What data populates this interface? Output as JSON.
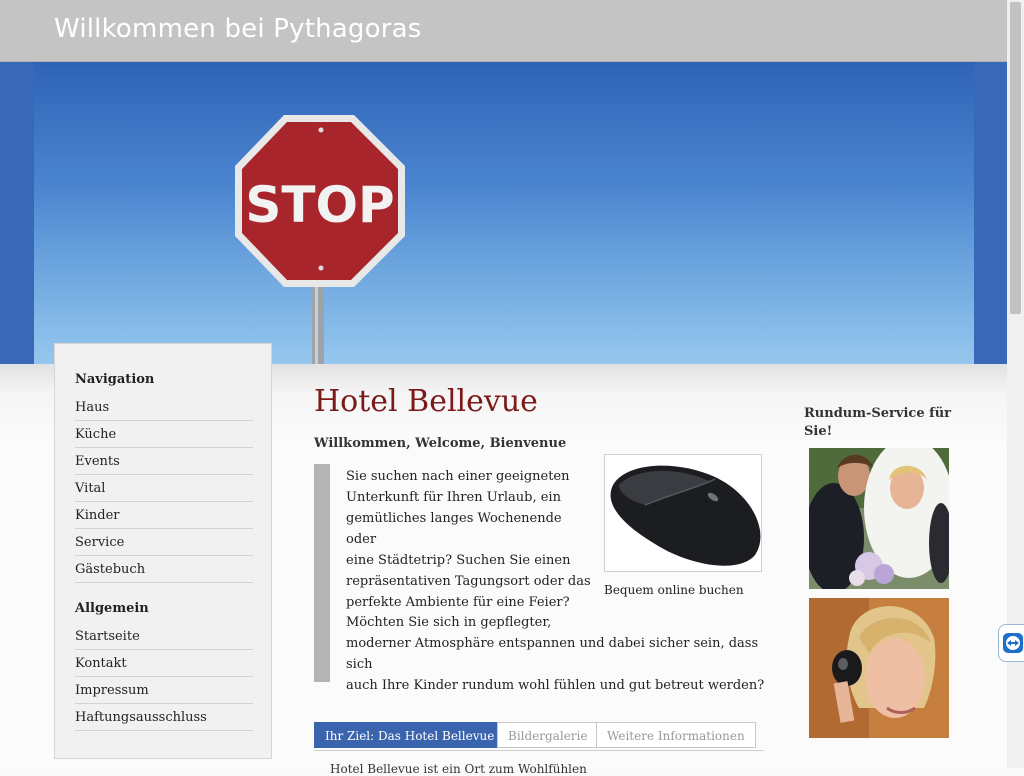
{
  "header": {
    "title": "Willkommen bei Pythagoras"
  },
  "hero": {
    "sign_text": "STOP"
  },
  "nav": {
    "navigation_heading": "Navigation",
    "navigation_items": [
      "Haus",
      "Küche",
      "Events",
      "Vital",
      "Kinder",
      "Service",
      "Gästebuch"
    ],
    "general_heading": "Allgemein",
    "general_items": [
      "Startseite",
      "Kontakt",
      "Impressum",
      "Haftungsausschluss"
    ]
  },
  "main": {
    "title": "Hotel Bellevue",
    "welcome": "Willkommen, Welcome, Bienvenue",
    "intro_lines": [
      "Sie suchen nach einer geeigneten",
      "Unterkunft für Ihren Urlaub, ein",
      "gemütliches langes Wochenende oder",
      "eine Städtetrip? Suchen Sie einen",
      "repräsentativen Tagungsort oder das",
      "perfekte Ambiente für eine Feier?"
    ],
    "second_lines": [
      "Möchten Sie sich in gepflegter,",
      "moderner Atmosphäre entspannen und dabei sicher sein, dass sich",
      "auch Ihre Kinder rundum wohl fühlen und gut betreut werden?"
    ],
    "mouse_caption": "Bequem online buchen",
    "tabs": [
      "Ihr Ziel: Das Hotel Bellevue",
      "Bildergalerie",
      "Weitere Informationen"
    ],
    "clipped_line": "Hotel Bellevue ist ein Ort zum Wohlfühlen"
  },
  "sidebar": {
    "title": "Rundum-Service für Sie!"
  },
  "colors": {
    "title_red": "#7b1a1a",
    "tab_active": "#3a64ad",
    "header_gray": "#c4c4c4",
    "sky_blue": "#3a68b9"
  }
}
